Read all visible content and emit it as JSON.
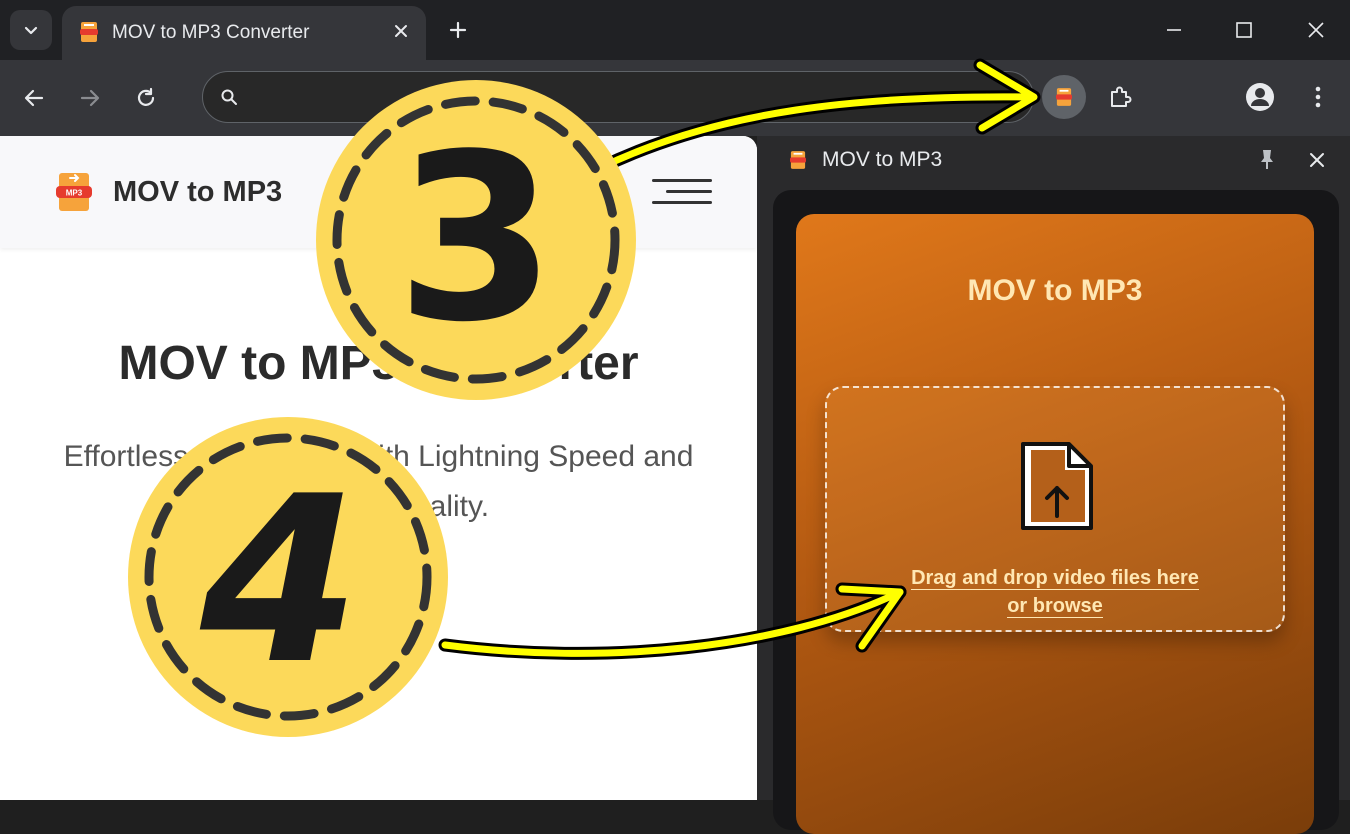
{
  "browser": {
    "tab_title": "MOV to MP3 Converter",
    "omnibox_value": ""
  },
  "page": {
    "brand": "MOV to MP3",
    "hero_title": "MOV to MP3 Converter",
    "hero_subtitle_line1": "Effortless Conversion with Lightning Speed and",
    "hero_subtitle_line2": "Superior Quality."
  },
  "side_panel": {
    "title": "MOV to MP3",
    "card_title": "MOV to MP3",
    "dropzone_line1": "Drag and drop video files here",
    "dropzone_line2": "or browse"
  },
  "annotations": {
    "step_3": "3",
    "step_4": "4"
  },
  "colors": {
    "accent_orange": "#e0781a",
    "badge_yellow": "#fcd95a",
    "arrow_yellow": "#ffff00"
  }
}
